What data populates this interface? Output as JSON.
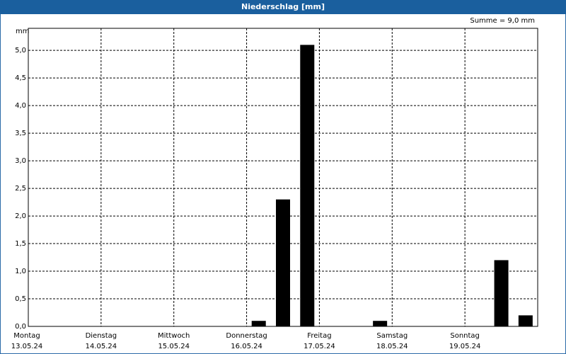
{
  "title": "Niederschlag [mm]",
  "sum_label": "Summe = 9,0 mm",
  "unit_label": "mm",
  "colors": {
    "titlebar": "#1a5f9e",
    "bars": "#000000",
    "grid": "#000000"
  },
  "chart_data": {
    "type": "bar",
    "title": "Niederschlag [mm]",
    "ylabel": "mm",
    "ylim": [
      0,
      5.4
    ],
    "yticks": [
      "0,0",
      "0,5",
      "1,0",
      "1,5",
      "2,0",
      "2,5",
      "3,0",
      "3,5",
      "4,0",
      "4,5",
      "5,0"
    ],
    "days": [
      {
        "name": "Montag",
        "date": "13.05.24"
      },
      {
        "name": "Dienstag",
        "date": "14.05.24"
      },
      {
        "name": "Mittwoch",
        "date": "15.05.24"
      },
      {
        "name": "Donnerstag",
        "date": "16.05.24"
      },
      {
        "name": "Freitag",
        "date": "17.05.24"
      },
      {
        "name": "Samstag",
        "date": "18.05.24"
      },
      {
        "name": "Sonntag",
        "date": "19.05.24"
      }
    ],
    "bars": [
      {
        "day": 3,
        "slot": 0,
        "value": 0.1
      },
      {
        "day": 3,
        "slot": 1,
        "value": 2.3
      },
      {
        "day": 3,
        "slot": 2,
        "value": 5.1
      },
      {
        "day": 4,
        "slot": 2,
        "value": 0.1
      },
      {
        "day": 6,
        "slot": 1,
        "value": 1.2
      },
      {
        "day": 6,
        "slot": 2,
        "value": 0.2
      }
    ],
    "slots_per_day": 3,
    "grid": true,
    "legend": "none"
  }
}
